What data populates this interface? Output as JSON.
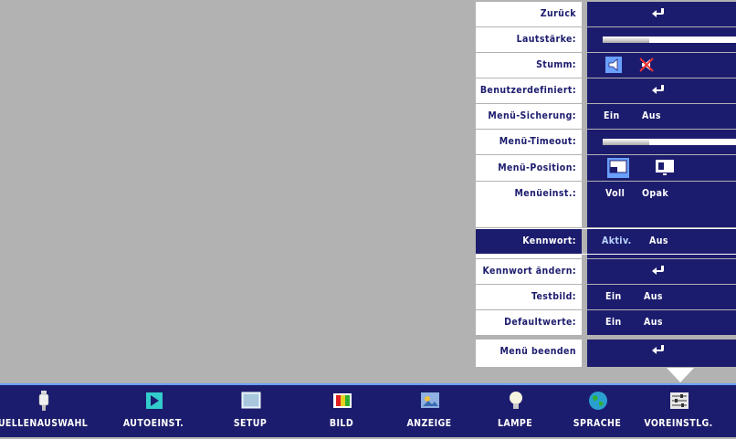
{
  "menu": {
    "items": [
      {
        "label": "Zurück",
        "kind": "return"
      },
      {
        "label": "Lautstärke:",
        "kind": "slider",
        "level_percent": 35
      },
      {
        "label": "Stumm:",
        "kind": "mute"
      },
      {
        "label": "Benutzerdefiniert:",
        "kind": "return"
      },
      {
        "label": "Menü-Sicherung:",
        "kind": "options",
        "options": [
          "Ein",
          "Aus"
        ]
      },
      {
        "label": "Menü-Timeout:",
        "kind": "slider",
        "level_percent": 35
      },
      {
        "label": "Menü-Position:",
        "kind": "position"
      },
      {
        "label": "Menüeinst.:",
        "kind": "options",
        "options": [
          "Voll",
          "Opak"
        ]
      },
      {
        "label": "Kennwort:",
        "kind": "options",
        "options": [
          "Aktiv.",
          "Aus"
        ],
        "selected": true
      },
      {
        "label": "Kennwort ändern:",
        "kind": "return"
      },
      {
        "label": "Testbild:",
        "kind": "options",
        "options": [
          "Ein",
          "Aus"
        ]
      },
      {
        "label": "Defaultwerte:",
        "kind": "options",
        "options": [
          "Ein",
          "Aus"
        ]
      },
      {
        "label": "Menü beenden",
        "kind": "return"
      }
    ]
  },
  "toolbar": {
    "items": [
      {
        "label": "UELLENAUSWAHL",
        "icon": "source-plug-icon"
      },
      {
        "label": "AUTOEINST.",
        "icon": "auto-play-icon"
      },
      {
        "label": "SETUP",
        "icon": "setup-screen-icon"
      },
      {
        "label": "BILD",
        "icon": "picture-color-icon"
      },
      {
        "label": "ANZEIGE",
        "icon": "display-icon"
      },
      {
        "label": "LAMPE",
        "icon": "lamp-bulb-icon"
      },
      {
        "label": "SPRACHE",
        "icon": "language-globe-icon"
      },
      {
        "label": "VOREINSTLG.",
        "icon": "preferences-sliders-icon"
      }
    ],
    "active_index": 7
  },
  "colors": {
    "background": "#b2b2b2",
    "menu_dark": "#1c1c6e",
    "menu_light": "#ffffff",
    "accent": "#6aa0ff"
  }
}
